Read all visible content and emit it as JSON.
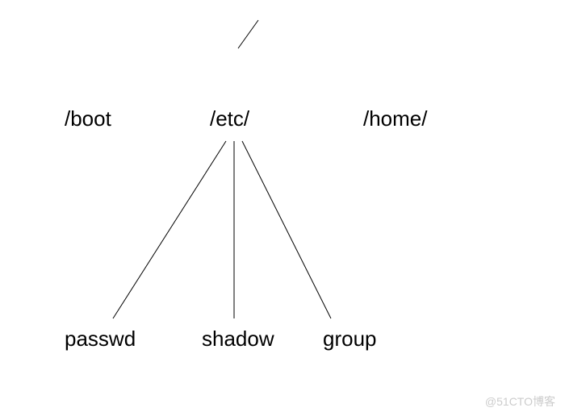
{
  "root": "/",
  "level1": {
    "boot": "/boot",
    "etc": "/etc/",
    "home": "/home/"
  },
  "level2": {
    "passwd": "passwd",
    "shadow": "shadow",
    "group": "group"
  },
  "watermark": "@51CTO博客"
}
